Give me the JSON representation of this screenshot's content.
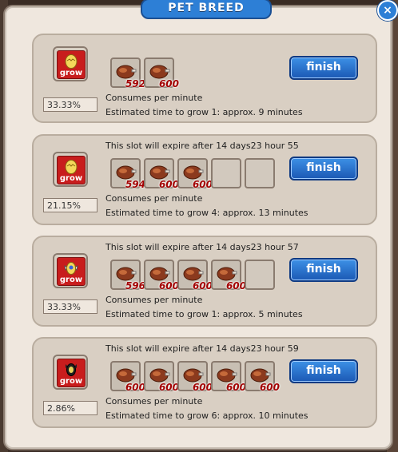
{
  "window": {
    "title": "PET BREED",
    "close_label": "×"
  },
  "slots": [
    {
      "icon": "egg-plain-icon",
      "icon_label": "grow",
      "percent": "33.33%",
      "expire_text": "",
      "foods": [
        {
          "amount": "592",
          "filled": true
        },
        {
          "amount": "600",
          "filled": true
        }
      ],
      "consumes": "Consumes per minute",
      "estimate": "Estimated time to grow 1: approx. 9 minutes",
      "finish": "finish"
    },
    {
      "icon": "egg-plain-icon",
      "icon_label": "grow",
      "percent": "21.15%",
      "expire_text": "This slot will expire after 14 days23 hour 55",
      "foods": [
        {
          "amount": "594",
          "filled": true
        },
        {
          "amount": "600",
          "filled": true
        },
        {
          "amount": "600",
          "filled": true
        },
        {
          "amount": "",
          "filled": false
        },
        {
          "amount": "",
          "filled": false
        }
      ],
      "consumes": "Consumes per minute",
      "estimate": "Estimated time to grow 4: approx. 13 minutes",
      "finish": "finish"
    },
    {
      "icon": "winged-egg-icon",
      "icon_label": "grow",
      "percent": "33.33%",
      "expire_text": "This slot will expire after 14 days23 hour 57",
      "foods": [
        {
          "amount": "596",
          "filled": true
        },
        {
          "amount": "600",
          "filled": true
        },
        {
          "amount": "600",
          "filled": true
        },
        {
          "amount": "600",
          "filled": true
        },
        {
          "amount": "",
          "filled": false
        }
      ],
      "consumes": "Consumes per minute",
      "estimate": "Estimated time to grow 1: approx. 5 minutes",
      "finish": "finish"
    },
    {
      "icon": "dark-creature-icon",
      "icon_label": "grow",
      "percent": "2.86%",
      "expire_text": "This slot will expire after 14 days23 hour 59",
      "foods": [
        {
          "amount": "600",
          "filled": true
        },
        {
          "amount": "600",
          "filled": true
        },
        {
          "amount": "600",
          "filled": true
        },
        {
          "amount": "600",
          "filled": true
        },
        {
          "amount": "600",
          "filled": true
        }
      ],
      "consumes": "Consumes per minute",
      "estimate": "Estimated time to grow 6: approx. 10 minutes",
      "finish": "finish"
    }
  ]
}
